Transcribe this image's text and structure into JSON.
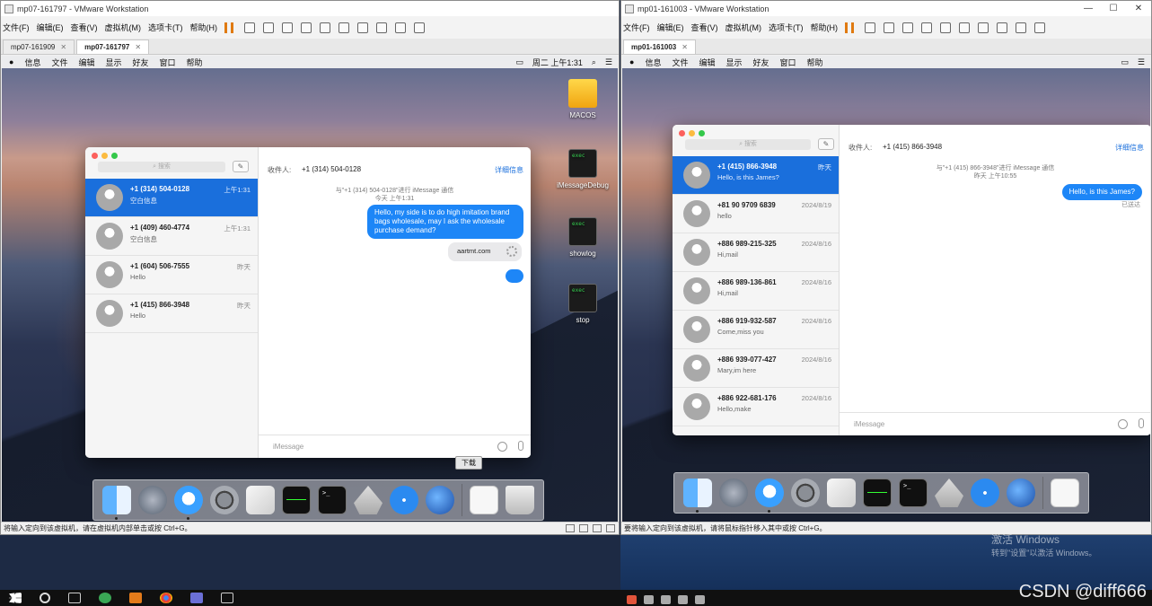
{
  "left_vm": {
    "title": "mp07-161797 - VMware Workstation",
    "menu": [
      "文件(F)",
      "编辑(E)",
      "查看(V)",
      "虚拟机(M)",
      "选项卡(T)",
      "帮助(H)"
    ],
    "tabs": [
      {
        "label": "mp07-161909",
        "active": false
      },
      {
        "label": "mp07-161797",
        "active": true
      }
    ],
    "status": "将输入定向到该虚拟机，请在虚拟机内部单击或按 Ctrl+G。",
    "mac_menu": [
      "信息",
      "文件",
      "编辑",
      "显示",
      "好友",
      "窗口",
      "帮助"
    ],
    "clock": "周二 上午1:31",
    "desktop_icons": [
      {
        "label": "MACOS",
        "icon": "drive-icon"
      },
      {
        "label": "iMessageDebug",
        "icon": "terminal-icon"
      },
      {
        "label": "showlog",
        "icon": "terminal-icon"
      },
      {
        "label": "stop",
        "icon": "terminal-icon"
      }
    ],
    "messages": {
      "search_placeholder": "搜索",
      "conversations": [
        {
          "name": "+1 (314) 504-0128",
          "preview": "空白信息",
          "time": "上午1:31",
          "selected": true
        },
        {
          "name": "+1 (409) 460-4774",
          "preview": "空白信息",
          "time": "上午1:31",
          "selected": false
        },
        {
          "name": "+1 (604) 506-7555",
          "preview": "Hello",
          "time": "昨天",
          "selected": false
        },
        {
          "name": "+1 (415) 866-3948",
          "preview": "Hello",
          "time": "昨天",
          "selected": false
        }
      ],
      "to_label": "收件人:",
      "to_value": "+1 (314) 504-0128",
      "details": "详细信息",
      "sys_note_1": "与\"+1 (314) 504-0128\"进行 iMessage 通信",
      "sys_note_2": "今天 上午1:31",
      "bubble": "Hello, my side is to do high imitation brand bags wholesale, may I ask the wholesale purchase demand?",
      "link": "aartmt.com",
      "composer_placeholder": "iMessage"
    },
    "dock_tooltip": "下载"
  },
  "right_vm": {
    "title": "mp01-161003 - VMware Workstation",
    "menu": [
      "文件(F)",
      "编辑(E)",
      "查看(V)",
      "虚拟机(M)",
      "选项卡(T)",
      "帮助(H)"
    ],
    "tabs": [
      {
        "label": "mp01-161003",
        "active": true
      }
    ],
    "status": "要将输入定向到该虚拟机，请将鼠标指针移入其中或按 Ctrl+G。",
    "mac_menu": [
      "信息",
      "文件",
      "编辑",
      "显示",
      "好友",
      "窗口",
      "帮助"
    ],
    "messages": {
      "search_placeholder": "搜索",
      "conversations": [
        {
          "name": "+1 (415) 866-3948",
          "preview": "Hello, is this James?",
          "time": "昨天",
          "selected": true
        },
        {
          "name": "+81 90 9709 6839",
          "preview": "hello",
          "time": "2024/8/19",
          "selected": false
        },
        {
          "name": "+886 989-215-325",
          "preview": "Hi,mail",
          "time": "2024/8/16",
          "selected": false
        },
        {
          "name": "+886 989-136-861",
          "preview": "Hi,mail",
          "time": "2024/8/16",
          "selected": false
        },
        {
          "name": "+886 919-932-587",
          "preview": "Come,miss you",
          "time": "2024/8/16",
          "selected": false
        },
        {
          "name": "+886 939-077-427",
          "preview": "Mary,im here",
          "time": "2024/8/16",
          "selected": false
        },
        {
          "name": "+886 922-681-176",
          "preview": "Hello,make",
          "time": "2024/8/16",
          "selected": false
        }
      ],
      "to_label": "收件人:",
      "to_value": "+1 (415) 866-3948",
      "details": "详细信息",
      "sys_note_1": "与\"+1 (415) 866-3948\"进行 iMessage 通信",
      "sys_note_2": "昨天 上午10:55",
      "bubble": "Hello, is this James?",
      "delivered": "已送达",
      "composer_placeholder": "iMessage"
    }
  },
  "host": {
    "activate_title": "激活 Windows",
    "activate_sub": "转到\"设置\"以激活 Windows。",
    "watermark": "CSDN @diff666"
  }
}
